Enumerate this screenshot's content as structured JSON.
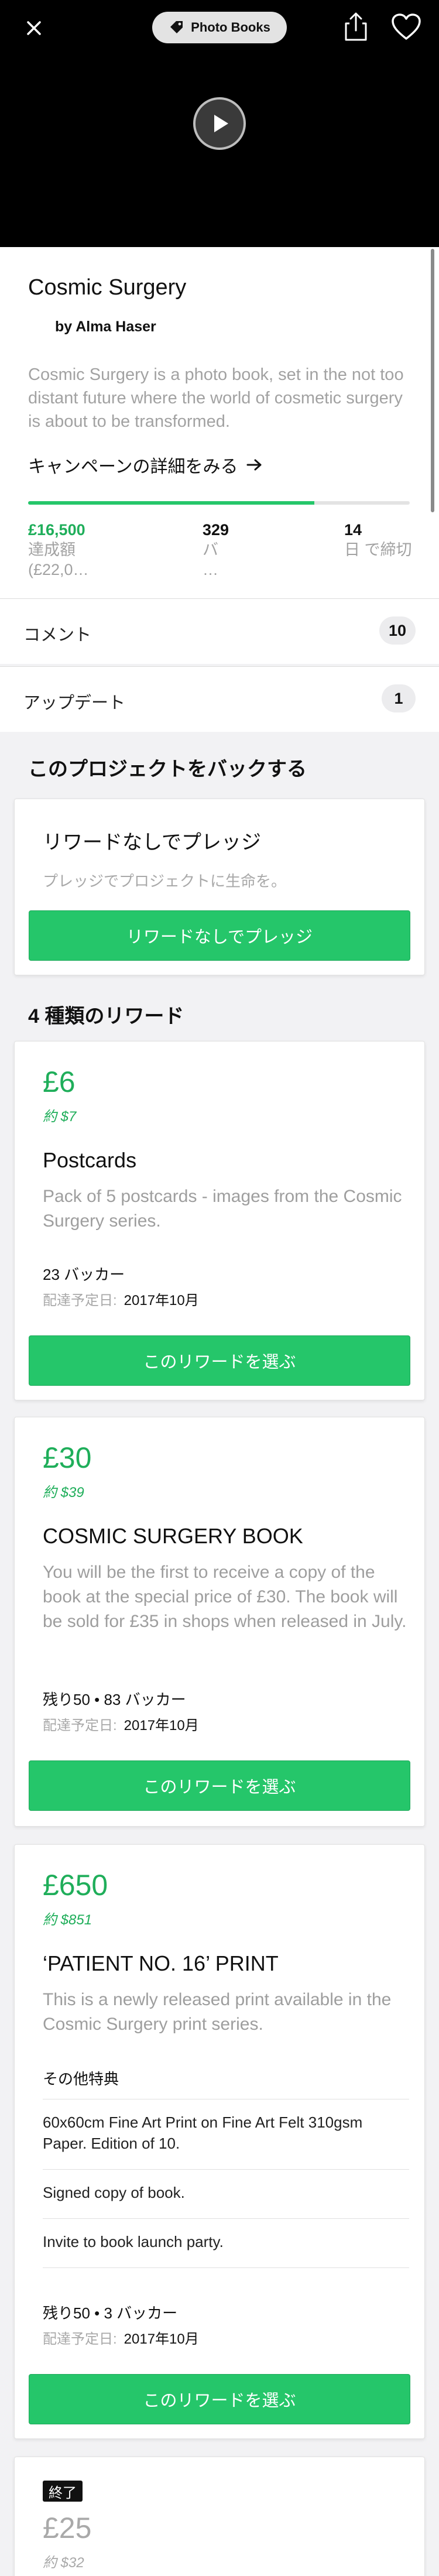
{
  "header": {
    "category": "Photo Books"
  },
  "project": {
    "title": "Cosmic Surgery",
    "byline": "by Alma Haser",
    "blurb": "Cosmic Surgery is a photo book, set in the not too distant future where the world of cosmetic surgery is about to be transformed.",
    "campaign_link": "キャンペーンの詳細をみる",
    "progress_fraction": 0.75,
    "stats": {
      "pledged": "£16,500",
      "pledged_label": "達成額",
      "pledged_goal": "(£22,0…",
      "backers": "329",
      "backers_label": "バ",
      "backers_more": "…",
      "days": "14",
      "days_label": "日 で締切"
    }
  },
  "rows": {
    "comments_label": "コメント",
    "comments_count": "10",
    "updates_label": "アップデート",
    "updates_count": "1"
  },
  "back_section": {
    "heading": "このプロジェクトをバックする",
    "no_reward_title": "リワードなしでプレッジ",
    "no_reward_sub": "プレッジでプロジェクトに生命を。",
    "no_reward_button": "リワードなしでプレッジ"
  },
  "rewards_heading": "4 種類のリワード",
  "rewards": [
    {
      "price": "£6",
      "approx": "約 $7",
      "title": "Postcards",
      "description": "Pack of 5 postcards - images from the Cosmic Surgery series.",
      "meta": "23 バッカー",
      "eta_label": "配達予定日:",
      "eta_value": "2017年10月",
      "button": "このリワードを選ぶ"
    },
    {
      "price": "£30",
      "approx": "約 $39",
      "title": "COSMIC SURGERY BOOK",
      "description": "You will be the first to receive a copy of the book at the special price of £30. The book will be sold for £35 in shops when released in July.",
      "meta": "残り50 • 83 バッカー",
      "eta_label": "配達予定日:",
      "eta_value": "2017年10月",
      "button": "このリワードを選ぶ"
    },
    {
      "price": "£650",
      "approx": "約 $851",
      "title": "‘PATIENT NO. 16’ PRINT",
      "description": "This is a newly released print available in the Cosmic Surgery print series.",
      "extras_heading": "その他特典",
      "extras": [
        "60x60cm Fine Art Print on Fine Art Felt 310gsm Paper. Edition of 10.",
        "Signed copy of book.",
        "Invite to book launch party."
      ],
      "meta": "残り50 • 3 バッカー",
      "eta_label": "配達予定日:",
      "eta_value": "2017年10月",
      "button": "このリワードを選ぶ"
    },
    {
      "status": "終了",
      "price": "£25",
      "approx": "約 $32"
    }
  ],
  "colors": {
    "accent_green": "#25c66a",
    "price_green": "#1fae5a",
    "muted_text": "#a2a2a2"
  },
  "icons": {
    "close": "close-icon",
    "category": "tag-icon",
    "share": "share-icon",
    "favorite": "heart-icon",
    "play": "play-icon",
    "arrow": "arrow-right-icon"
  }
}
